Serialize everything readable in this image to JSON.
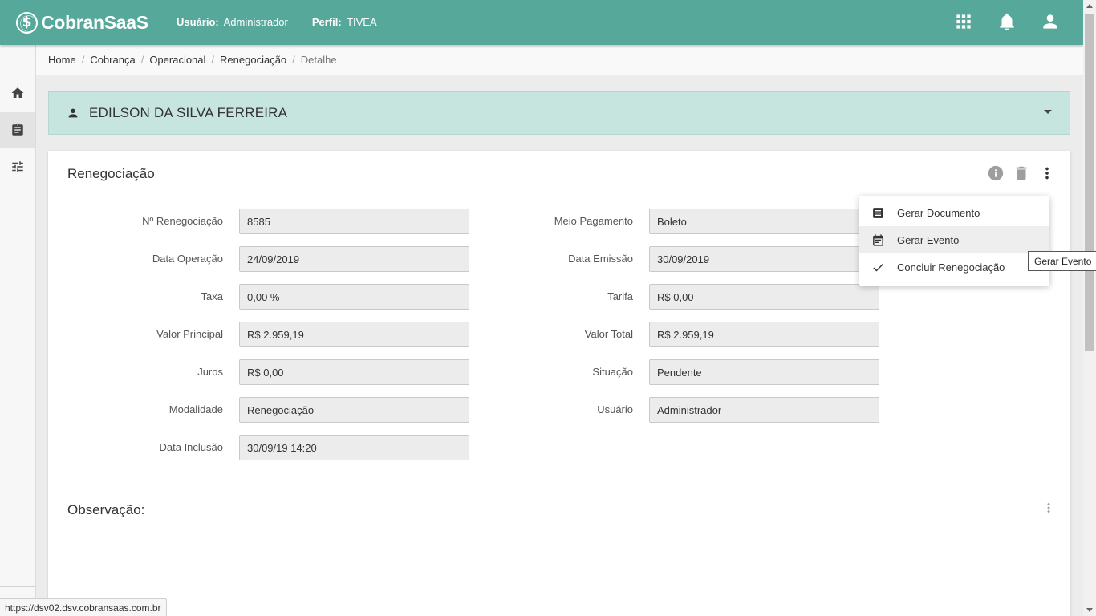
{
  "header": {
    "logo_mark": "$",
    "logo_text": "CobranSaaS",
    "user_label": "Usuário:",
    "user_value": "Administrador",
    "profile_label": "Perfil:",
    "profile_value": "TIVEA"
  },
  "breadcrumb": {
    "items": [
      "Home",
      "Cobrança",
      "Operacional",
      "Renegociação"
    ],
    "current": "Detalhe",
    "separator": "/"
  },
  "client": {
    "name": "EDILSON DA SILVA FERREIRA"
  },
  "card": {
    "title": "Renegociação",
    "left_fields": [
      {
        "label": "Nº Renegociação",
        "value": "8585"
      },
      {
        "label": "Data Operação",
        "value": "24/09/2019"
      },
      {
        "label": "Taxa",
        "value": "0,00 %"
      },
      {
        "label": "Valor Principal",
        "value": "R$ 2.959,19"
      },
      {
        "label": "Juros",
        "value": "R$ 0,00"
      },
      {
        "label": "Modalidade",
        "value": "Renegociação"
      },
      {
        "label": "Data Inclusão",
        "value": "30/09/19 14:20"
      }
    ],
    "right_fields": [
      {
        "label": "Meio Pagamento",
        "value": "Boleto"
      },
      {
        "label": "Data Emissão",
        "value": "30/09/2019"
      },
      {
        "label": "Tarifa",
        "value": "R$ 0,00"
      },
      {
        "label": "Valor Total",
        "value": "R$ 2.959,19"
      },
      {
        "label": "Situação",
        "value": "Pendente"
      },
      {
        "label": "Usuário",
        "value": "Administrador"
      }
    ],
    "observation_title": "Observação:"
  },
  "menu": {
    "items": [
      {
        "label": "Gerar Documento",
        "icon": "document-icon"
      },
      {
        "label": "Gerar Evento",
        "icon": "event-icon"
      },
      {
        "label": "Concluir Renegociação",
        "icon": "check-icon"
      }
    ]
  },
  "tooltip": "Gerar Evento",
  "status_url": "https://dsv02.dsv.cobransaas.com.br",
  "colors": {
    "header": "#56a89a",
    "client_panel": "#c7e5df"
  }
}
